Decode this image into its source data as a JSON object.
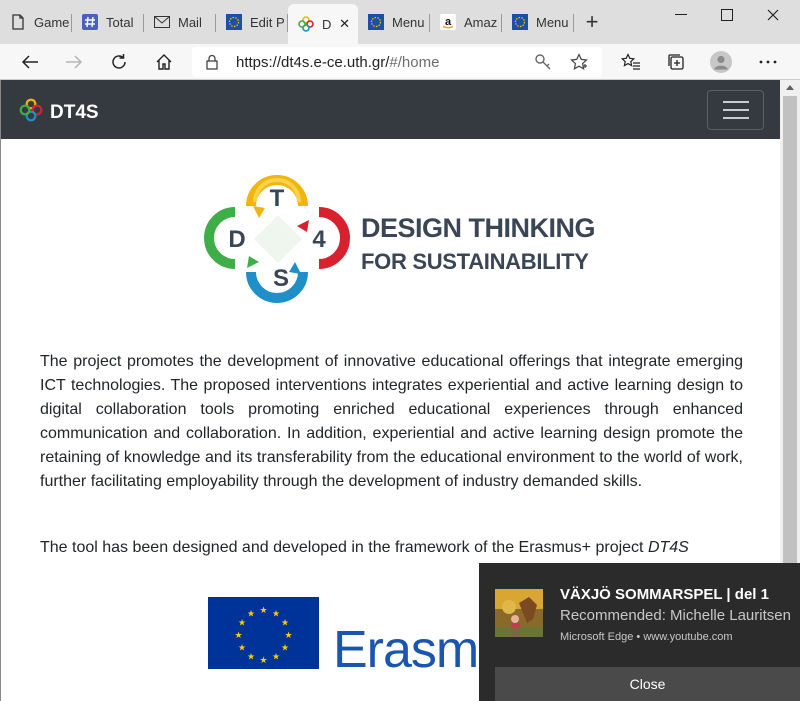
{
  "browser": {
    "tabs": [
      {
        "label": "Game",
        "icon": "page-icon"
      },
      {
        "label": "Total",
        "icon": "hash-icon"
      },
      {
        "label": "Mail",
        "icon": "mail-icon"
      },
      {
        "label": "Edit P",
        "icon": "eu-flag-icon"
      },
      {
        "label": "D",
        "icon": "dt4s-icon",
        "active": true
      },
      {
        "label": "Menu",
        "icon": "eu-flag-icon"
      },
      {
        "label": "Amaz",
        "icon": "amazon-icon"
      },
      {
        "label": "Menu",
        "icon": "eu-flag-icon"
      }
    ],
    "address": {
      "host": "https://dt4s.e-ce.uth.gr/",
      "path": "#/home"
    }
  },
  "site": {
    "brand": "DT4S",
    "logo": {
      "letters": [
        "T",
        "4",
        "S",
        "D"
      ],
      "title": "DESIGN THINKING",
      "subtitle": "FOR SUSTAINABILITY"
    },
    "paragraph": "The project promotes the development of innovative educational offerings that integrate emerging ICT technologies. The proposed interventions integrates experiential and active learning design to digital collaboration tools promoting enriched educational experiences through enhanced communication and collaboration. In addition, experiential and active learning design promote the retaining of knowledge and its transferability from the educational environment to the world of work, further facilitating employability through the development of industry demanded skills.",
    "framework_text": "The tool has been designed and developed in the framework of the Erasmus+ project ",
    "framework_project": "DT4S",
    "erasmus_text": "Erasm"
  },
  "notification": {
    "title": "VÄXJÖ SOMMARSPEL | del 1",
    "body": "Recommended: Michelle Lauritsen",
    "source": "Microsoft Edge • www.youtube.com",
    "close_label": "Close"
  },
  "colors": {
    "navbar": "#343a40",
    "tab_strip": "#dedede",
    "logo_yellow": "#f2b40f",
    "logo_red": "#d8202f",
    "logo_blue": "#1f8fc8",
    "logo_green": "#3fae49",
    "eu_blue": "#003399",
    "eu_star": "#ffcc00"
  }
}
